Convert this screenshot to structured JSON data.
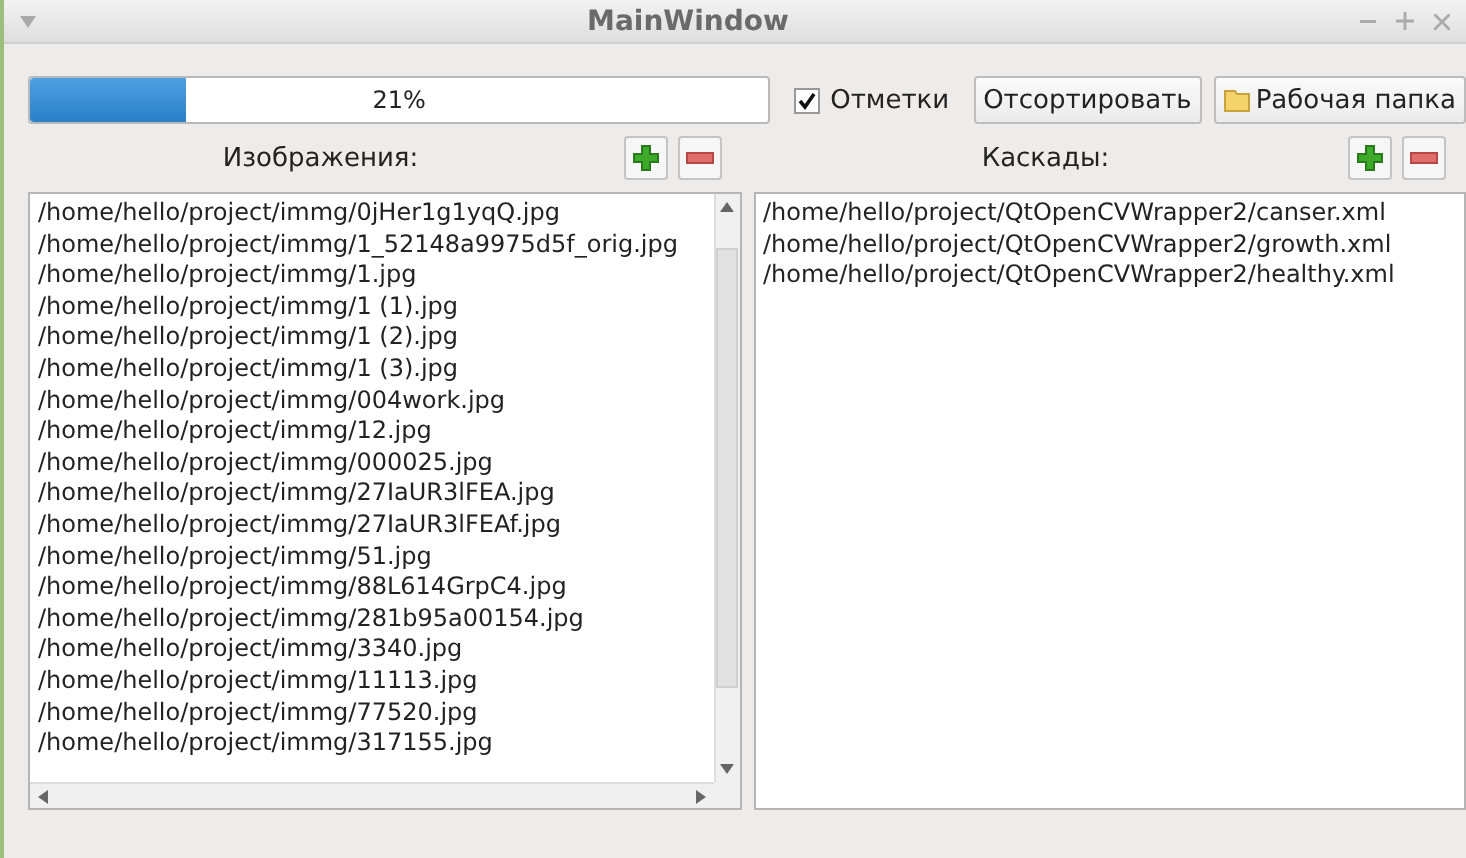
{
  "window": {
    "title": "MainWindow"
  },
  "progress": {
    "level": 0.21,
    "reading": "21%"
  },
  "marks_checkbox": {
    "label": "Отметки",
    "checked": true
  },
  "sort_button": "Отсортировать",
  "folder_button": "Рабочая папка",
  "images": {
    "label": "Изображения:",
    "items": [
      "/home/hello/project/immg/0jHer1g1yqQ.jpg",
      "/home/hello/project/immg/1_52148a9975d5f_orig.jpg",
      "/home/hello/project/immg/1.jpg",
      "/home/hello/project/immg/1 (1).jpg",
      "/home/hello/project/immg/1 (2).jpg",
      "/home/hello/project/immg/1 (3).jpg",
      "/home/hello/project/immg/004work.jpg",
      "/home/hello/project/immg/12.jpg",
      "/home/hello/project/immg/000025.jpg",
      "/home/hello/project/immg/27IaUR3lFEA.jpg",
      "/home/hello/project/immg/27IaUR3lFEAf.jpg",
      "/home/hello/project/immg/51.jpg",
      "/home/hello/project/immg/88L614GrpC4.jpg",
      "/home/hello/project/immg/281b95a00154.jpg",
      "/home/hello/project/immg/3340.jpg",
      "/home/hello/project/immg/11113.jpg",
      "/home/hello/project/immg/77520.jpg",
      "/home/hello/project/immg/317155.jpg"
    ]
  },
  "cascades": {
    "label": "Каскады:",
    "items": [
      "/home/hello/project/QtOpenCVWrapper2/canser.xml",
      "/home/hello/project/QtOpenCVWrapper2/growth.xml",
      "/home/hello/project/QtOpenCVWrapper2/healthy.xml"
    ]
  }
}
